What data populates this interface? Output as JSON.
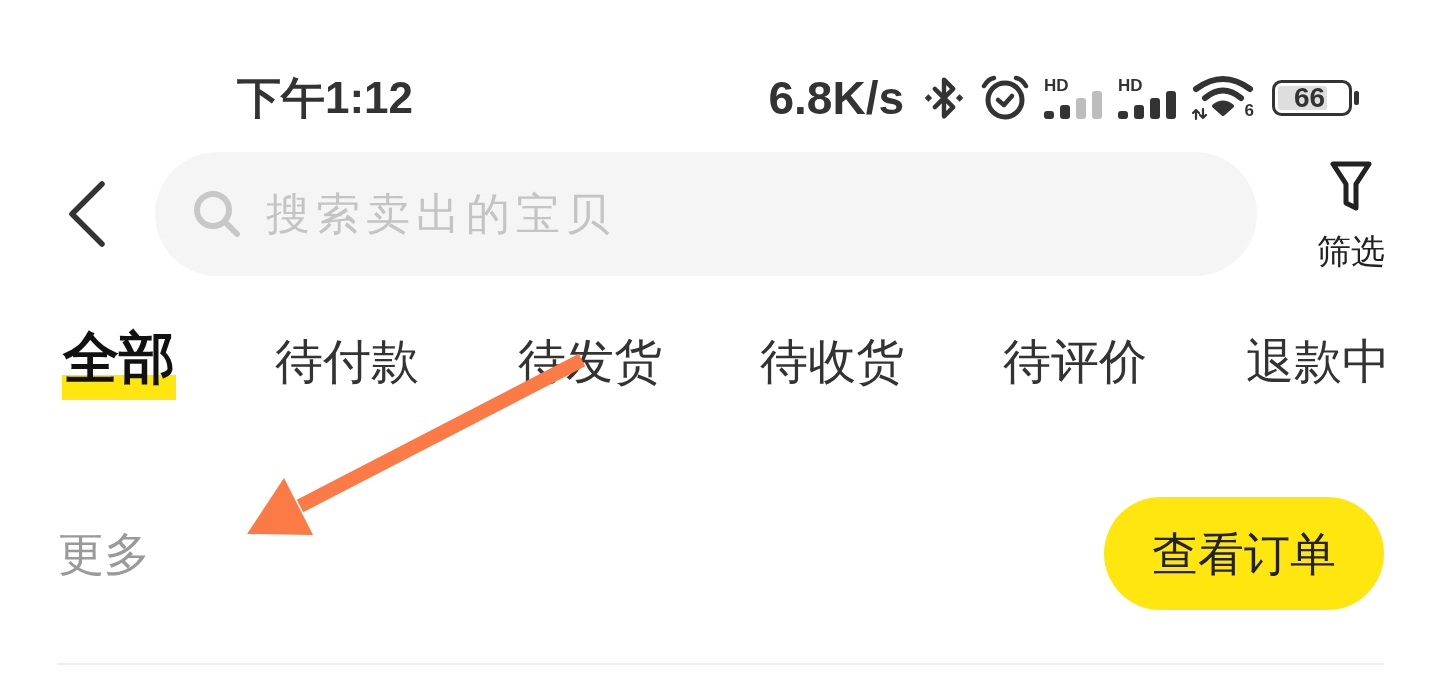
{
  "status_bar": {
    "time": "下午1:12",
    "network_speed": "6.8K/s",
    "signals": [
      {
        "label": "HD"
      },
      {
        "label": "HD"
      }
    ],
    "wifi": {
      "label": "6"
    },
    "battery": {
      "reading": "66"
    }
  },
  "search": {
    "placeholder": "搜索卖出的宝贝"
  },
  "filter_button": {
    "label": "筛选"
  },
  "tabs": [
    {
      "label": "全部",
      "selected": true
    },
    {
      "label": "待付款",
      "selected": false
    },
    {
      "label": "待发货",
      "selected": false
    },
    {
      "label": "待收货",
      "selected": false
    },
    {
      "label": "待评价",
      "selected": false
    },
    {
      "label": "退款中",
      "selected": false
    }
  ],
  "more": {
    "label": "更多"
  },
  "view_order_button": {
    "label": "查看订单"
  }
}
